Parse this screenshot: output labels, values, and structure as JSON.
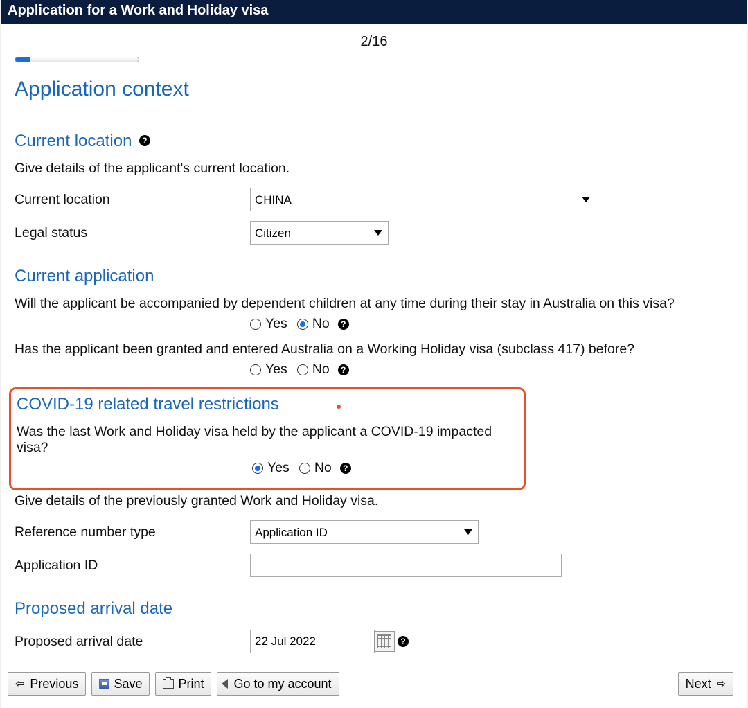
{
  "header": {
    "title": "Application for a Work and Holiday visa"
  },
  "pager": "2/16",
  "h1": "Application context",
  "current_location": {
    "heading": "Current location",
    "instr": "Give details of the applicant's current location.",
    "location_label": "Current location",
    "location_value": "CHINA",
    "legal_status_label": "Legal status",
    "legal_status_value": "Citizen"
  },
  "current_app": {
    "heading": "Current application",
    "q1": "Will the applicant be accompanied by dependent children at any time during their stay in Australia on this visa?",
    "q2": "Has the applicant been granted and entered Australia on a Working Holiday visa (subclass 417) before?",
    "yes": "Yes",
    "no": "No",
    "q1_sel": "No",
    "q2_sel": ""
  },
  "covid": {
    "heading": "COVID-19 related travel restrictions",
    "q": "Was the last Work and Holiday visa held by the applicant a COVID-19 impacted visa?",
    "yes": "Yes",
    "no": "No",
    "sel": "Yes",
    "instr2": "Give details of the previously granted Work and Holiday visa.",
    "ref_label": "Reference number type",
    "ref_value": "Application ID",
    "appid_label": "Application ID",
    "appid_value": ""
  },
  "arrival": {
    "heading": "Proposed arrival date",
    "label": "Proposed arrival date",
    "value": "22 Jul 2022"
  },
  "footer": {
    "prev": "Previous",
    "save": "Save",
    "print": "Print",
    "account": "Go to my account",
    "next": "Next"
  }
}
